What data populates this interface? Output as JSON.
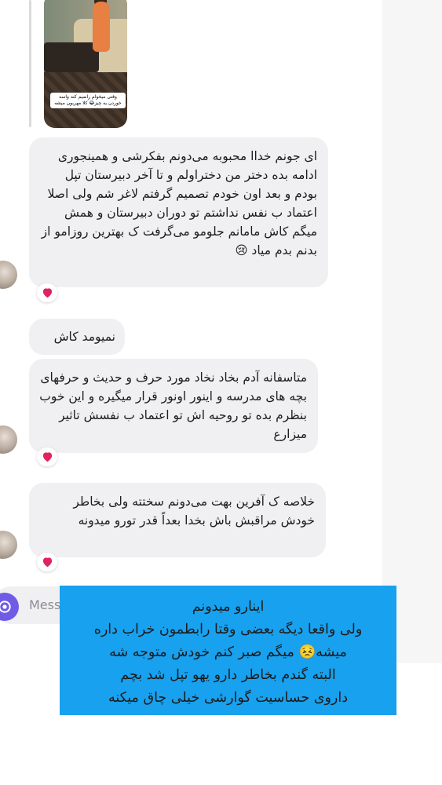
{
  "photo": {
    "caption": "وقتی میخوام راضیم کنه واسه خوردن یه چیز😂 کلا مهربون میشه"
  },
  "messages": [
    {
      "text": "ای جونم خداا محبوبه می‌دونم بفکرشی و همینجوری ادامه بده دختر من دختراولم و تا آخر دبیرستان تپل بودم و بعد اون خودم تصمیم گرفتم لاغر شم ولی اصلا اعتماد ب نفس نداشتم تو دوران دبیرستان و همش میگم کاش مامانم جلومو می‌گرفت ک بهترین روزامو از بدنم بدم میاد 😢",
      "reaction": "❤️"
    },
    {
      "text": "نمیومد کاش"
    },
    {
      "text": "متاسفانه آدم بخاد نخاد مورد حرف و حدیث و حرفهای بچه های مدرسه و اینور اونور قرار میگیره و این خوب بنظرم بده تو روحیه اش تو اعتماد ب نفسش تاثیر میزارع",
      "reaction": "❤️"
    },
    {
      "text": "خلاصه ک آفرین بهت می‌دونم سختته ولی بخاطر خودش مراقبش باش بخدا بعداً قدر تورو میدونه",
      "reaction": "❤️"
    }
  ],
  "composer": {
    "placeholder": "Message..."
  },
  "overlay": {
    "lines": [
      "اینارو میدونم",
      "ولی واقعا دیگه بعضی وقتا رابطمون خراب داره",
      "میشه😣 میگم صبر کنم خودش متوجه شه",
      "البته گندم بخاطر دارو یهو تپل شد بچم",
      "داروی حساسیت گوارشی خیلی چاق میکنه"
    ]
  },
  "colors": {
    "bubble": "#f0f0f2",
    "overlay": "#18a1ee",
    "camera_button": "#6e5ce7",
    "heart": "#e0245e"
  }
}
